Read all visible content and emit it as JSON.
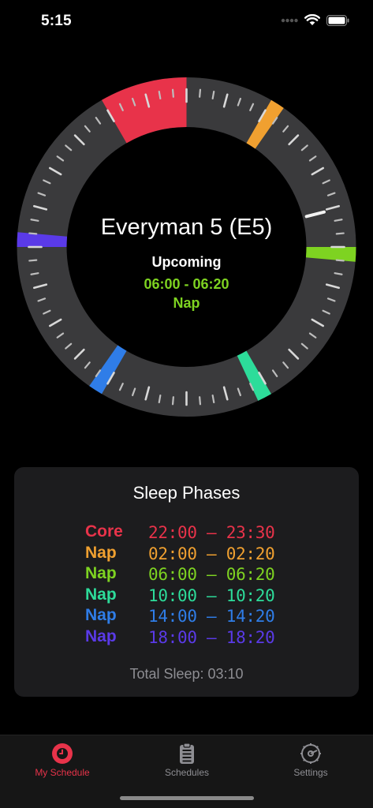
{
  "status_bar": {
    "time": "5:15",
    "icons": [
      "signal-dots-icon",
      "wifi-icon",
      "battery-icon"
    ]
  },
  "dial": {
    "schedule_name": "Everyman 5 (E5)",
    "upcoming_label": "Upcoming",
    "upcoming_time": "06:00 - 06:20",
    "upcoming_type": "Nap",
    "upcoming_color": "#7ed321",
    "current_time_fraction": 0.2104,
    "segments": [
      {
        "type": "Core",
        "start_fraction": 0.9167,
        "end_fraction": 0.0,
        "color": "#e8334a"
      },
      {
        "type": "Nap",
        "start_fraction": 0.0833,
        "end_fraction": 0.0972,
        "color": "#f0a030"
      },
      {
        "type": "Nap",
        "start_fraction": 0.25,
        "end_fraction": 0.2639,
        "color": "#7ed321"
      },
      {
        "type": "Nap",
        "start_fraction": 0.4167,
        "end_fraction": 0.4306,
        "color": "#2ddc9a"
      },
      {
        "type": "Nap",
        "start_fraction": 0.5833,
        "end_fraction": 0.5972,
        "color": "#2f7de8"
      },
      {
        "type": "Nap",
        "start_fraction": 0.75,
        "end_fraction": 0.7639,
        "color": "#5a3ae8"
      }
    ]
  },
  "sleep_phases": {
    "title": "Sleep Phases",
    "phases": [
      {
        "type": "Core",
        "range": "22:00 – 23:30",
        "color": "#e8334a"
      },
      {
        "type": "Nap",
        "range": "02:00 – 02:20",
        "color": "#f0a030"
      },
      {
        "type": "Nap",
        "range": "06:00 – 06:20",
        "color": "#7ed321"
      },
      {
        "type": "Nap",
        "range": "10:00 – 10:20",
        "color": "#2ddc9a"
      },
      {
        "type": "Nap",
        "range": "14:00 – 14:20",
        "color": "#2f7de8"
      },
      {
        "type": "Nap",
        "range": "18:00 – 18:20",
        "color": "#5a3ae8"
      }
    ],
    "total_sleep": "Total Sleep: 03:10"
  },
  "tab_bar": {
    "tabs": [
      {
        "label": "My Schedule",
        "icon": "clock-icon",
        "active": true
      },
      {
        "label": "Schedules",
        "icon": "clipboard-icon",
        "active": false
      },
      {
        "label": "Settings",
        "icon": "gear-icon",
        "active": false
      }
    ],
    "accent_color": "#e8334a"
  }
}
